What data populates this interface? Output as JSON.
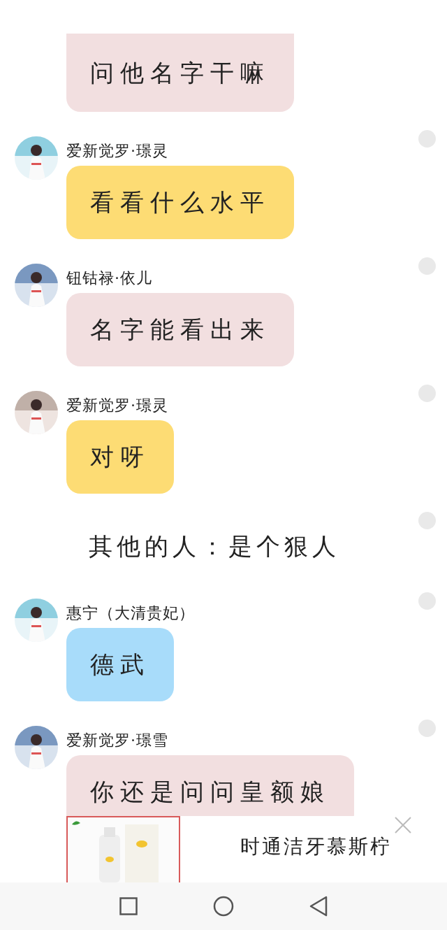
{
  "messages": [
    {
      "kind": "partial",
      "text": "问他名字干嘛",
      "color": "#f2dfe0"
    },
    {
      "kind": "message",
      "name": "爱新觉罗·璟灵",
      "text": "看看什么水平",
      "color": "#fddc74"
    },
    {
      "kind": "message",
      "name": "钮钴禄·依儿",
      "text": "名字能看出来",
      "color": "#f2dfe0"
    },
    {
      "kind": "message",
      "name": "爱新觉罗·璟灵",
      "text": "对呀",
      "color": "#fddc74"
    },
    {
      "kind": "narration",
      "text": "其他的人：是个狠人"
    },
    {
      "kind": "message",
      "name": "惠宁（大清贵妃）",
      "text": "德武",
      "color": "#a8dcfa"
    },
    {
      "kind": "message",
      "name": "爱新觉罗·璟雪",
      "text": "你还是问问皇额娘",
      "color": "#f2dfe0"
    }
  ],
  "ad": {
    "title": "时通洁牙慕斯柠"
  }
}
